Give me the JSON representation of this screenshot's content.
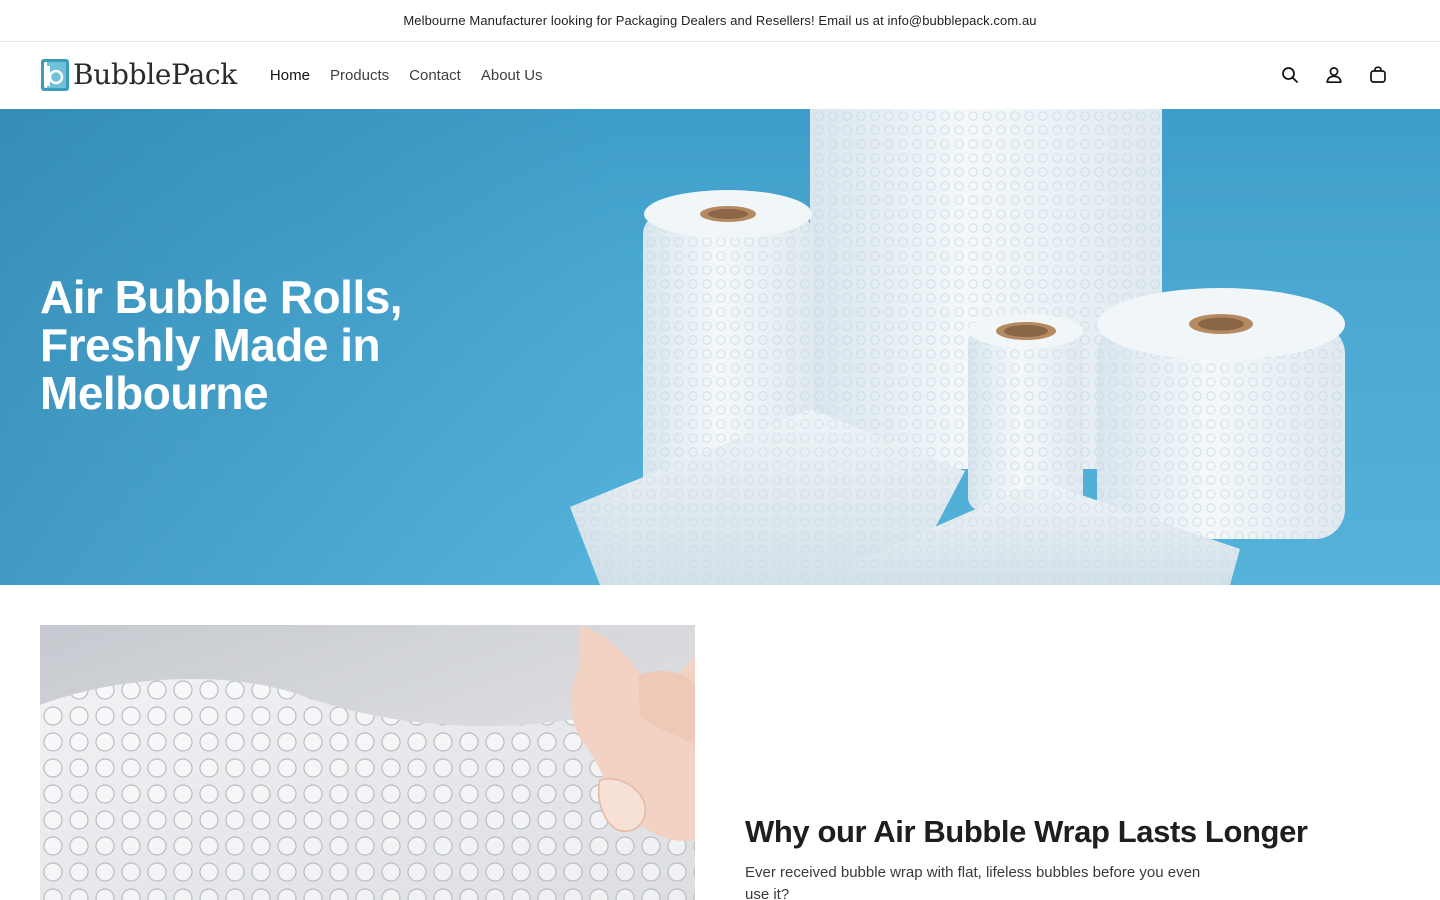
{
  "announcement": {
    "text": "Melbourne Manufacturer looking for Packaging Dealers and Resellers! Email us at info@bubblepack.com.au"
  },
  "header": {
    "logo_text": "BubblePack",
    "nav": [
      {
        "label": "Home",
        "active": true
      },
      {
        "label": "Products",
        "active": false
      },
      {
        "label": "Contact",
        "active": false
      },
      {
        "label": "About Us",
        "active": false
      }
    ],
    "icons": [
      "search-icon",
      "account-icon",
      "cart-icon"
    ]
  },
  "hero": {
    "title": "Air Bubble Rolls, Freshly Made in Melbourne",
    "background_color": "#4aa8d2"
  },
  "feature": {
    "title": "Why our Air Bubble Wrap Lasts Longer",
    "text": "Ever received bubble wrap with flat, lifeless bubbles before you even use it?"
  },
  "colors": {
    "brand": "#3a9bb8",
    "text": "#121212"
  }
}
